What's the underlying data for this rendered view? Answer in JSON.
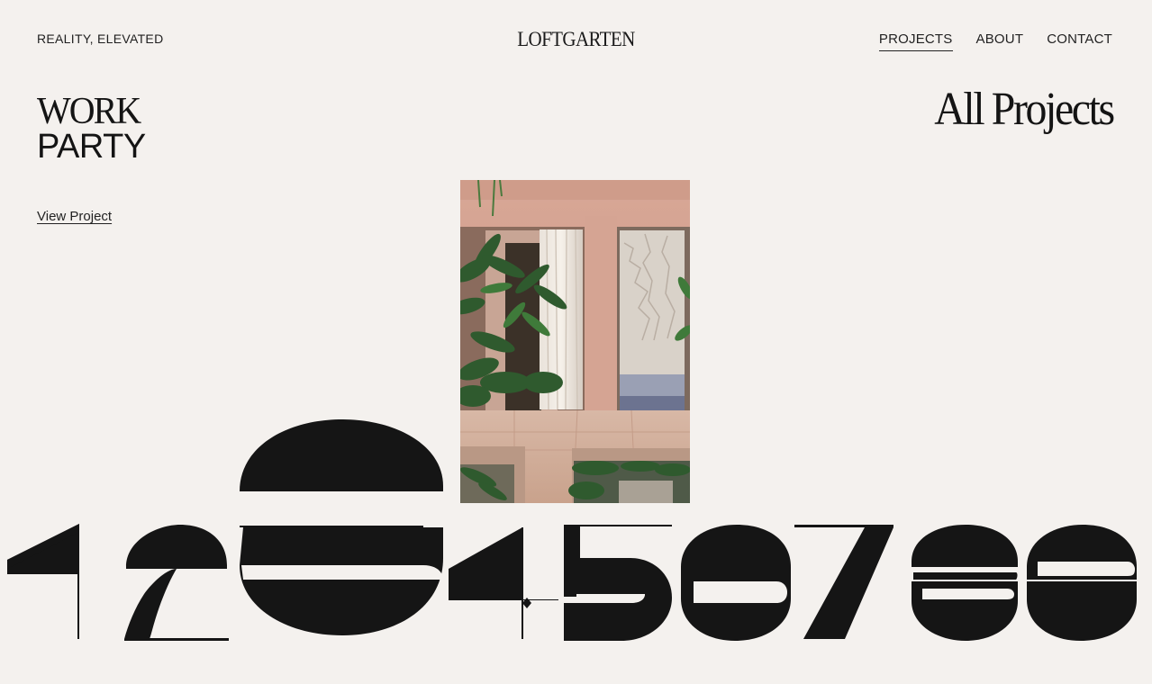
{
  "header": {
    "tagline": "REALITY, ELEVATED",
    "logo": "LOFTGARTEN",
    "nav": [
      {
        "label": "PROJECTS",
        "active": true
      },
      {
        "label": "ABOUT",
        "active": false
      },
      {
        "label": "CONTACT",
        "active": false
      }
    ]
  },
  "project": {
    "title_line1": "WORK",
    "title_line2": "PARTY",
    "link_label": "View Project",
    "image_alt": "Pink stucco courtyard with tropical plants, curtains and reflecting pool"
  },
  "all_projects_label": "All Projects",
  "number_strip": {
    "digits": [
      "1",
      "2",
      "3",
      "4",
      "5",
      "6",
      "7",
      "8",
      "9"
    ],
    "highlighted": "3"
  },
  "colors": {
    "background": "#f4f1ee",
    "ink": "#1a1a1a",
    "image_wall": "#d9ab9a",
    "image_foliage": "#2f5a2e"
  }
}
